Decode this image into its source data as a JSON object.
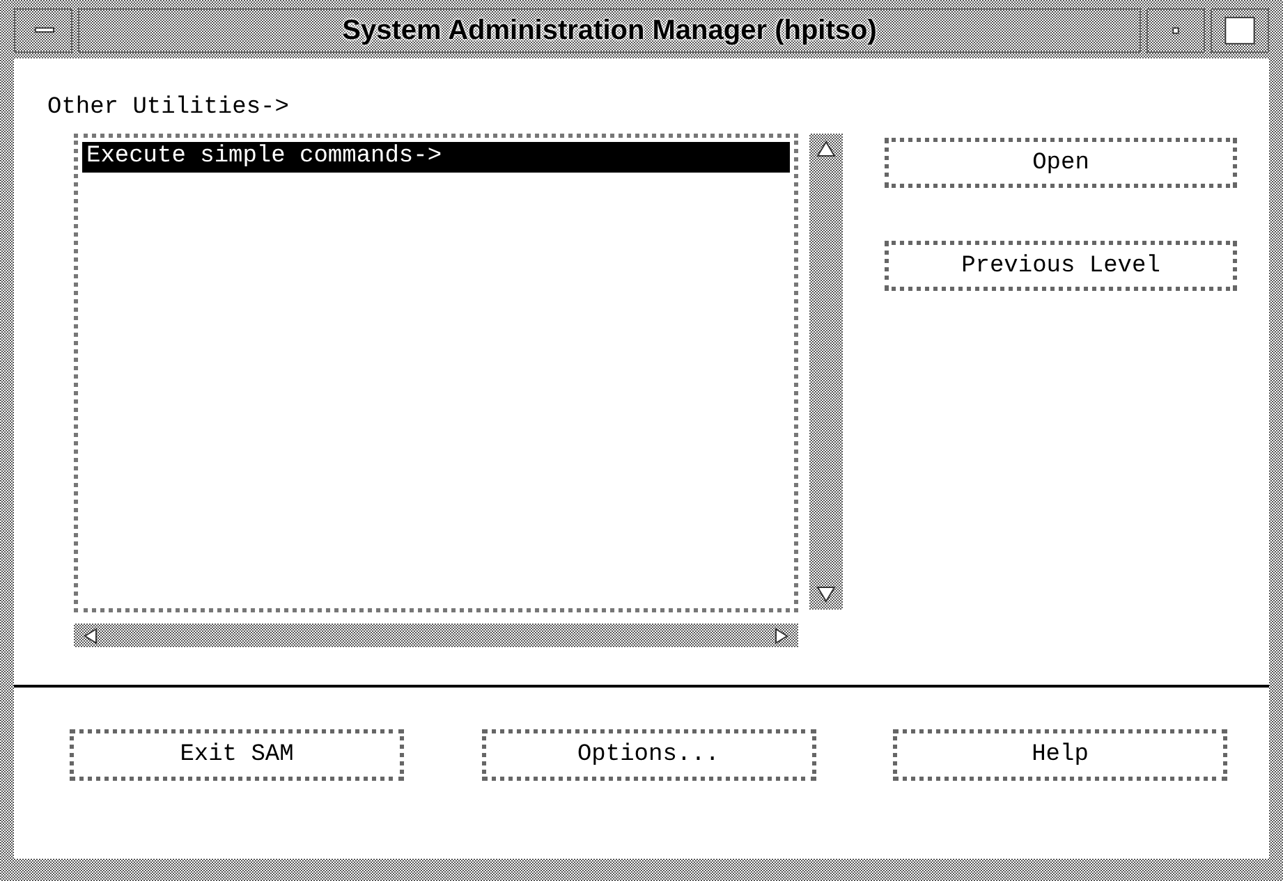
{
  "window": {
    "title": "System Administration Manager (hpitso)"
  },
  "path_label": "Other Utilities->",
  "list": {
    "items": [
      {
        "label": "Execute simple commands->",
        "selected": true
      }
    ]
  },
  "side_buttons": [
    "Open",
    "Previous Level"
  ],
  "bottom_buttons": [
    "Exit SAM",
    "Options...",
    "Help"
  ]
}
